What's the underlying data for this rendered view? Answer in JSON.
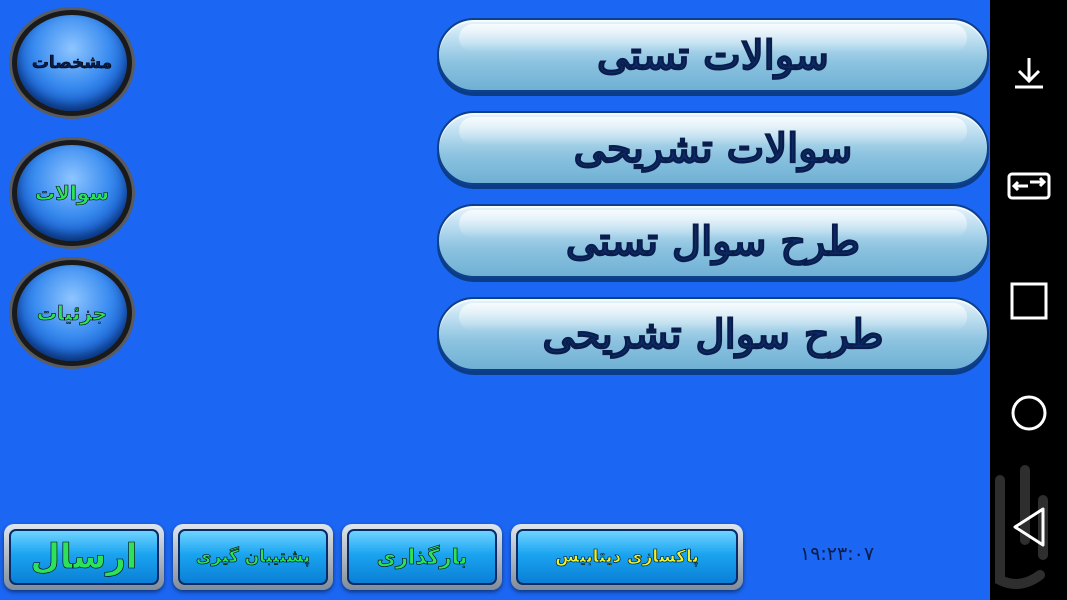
{
  "main_buttons": [
    {
      "label": "سوالات تستی"
    },
    {
      "label": "سوالات تشریحی"
    },
    {
      "label": "طرح سوال تستی"
    },
    {
      "label": "طرح سوال تشریحی"
    }
  ],
  "side_buttons": [
    {
      "label": "مشخصات",
      "color": "#0a1d4a"
    },
    {
      "label": "سوالات",
      "color": "#2ee05a"
    },
    {
      "label": "جزئیات",
      "color": "#2ee05a"
    }
  ],
  "bottom_buttons": [
    {
      "label": "ارسال"
    },
    {
      "label": "پشتیبان گیری"
    },
    {
      "label": "بارگذاری"
    },
    {
      "label": "پاکسازی دیتابیس"
    }
  ],
  "clock": "۱۹:۲۳:۰۷",
  "navbar": {
    "icons": [
      "download-icon",
      "swap-icon",
      "recents-icon",
      "home-icon",
      "back-icon"
    ]
  },
  "colors": {
    "background": "#1b66f3",
    "green_text": "#2ee05a",
    "dark_text": "#0a1d4a"
  }
}
